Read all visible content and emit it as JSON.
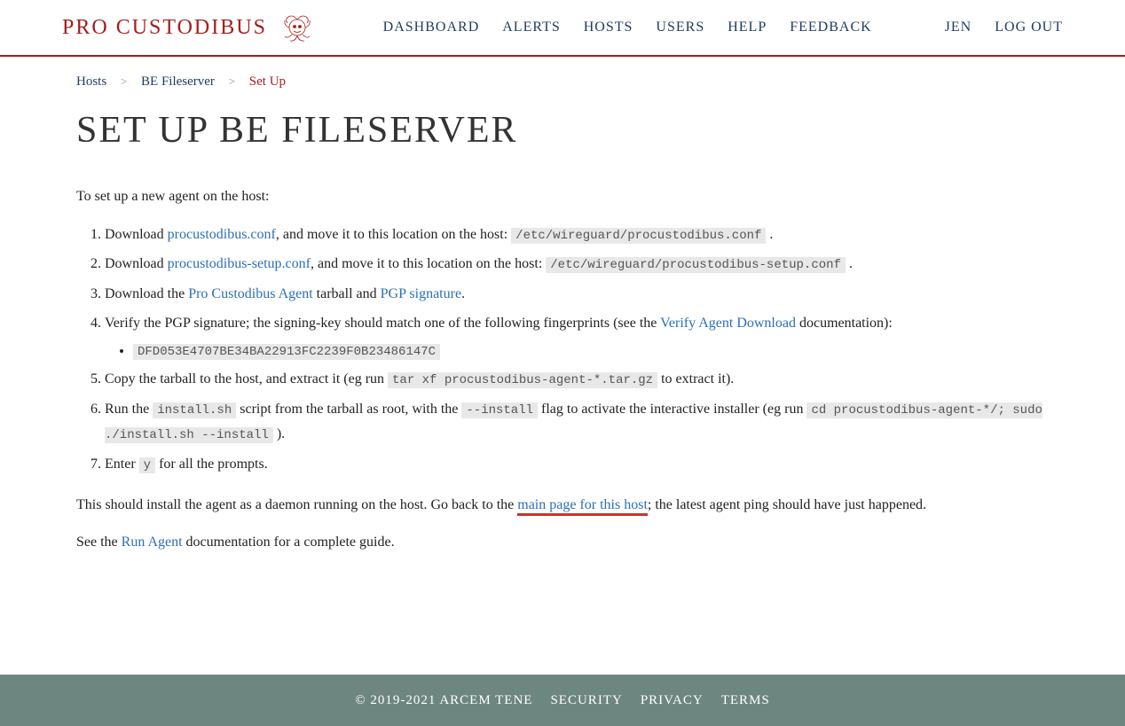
{
  "header": {
    "logo_text": "PRO CUSTODIBUS",
    "nav": [
      "DASHBOARD",
      "ALERTS",
      "HOSTS",
      "USERS",
      "HELP",
      "FEEDBACK"
    ],
    "user": "JEN",
    "logout": "LOG OUT"
  },
  "breadcrumbs": {
    "items": [
      {
        "label": "Hosts"
      },
      {
        "label": "BE Fileserver"
      }
    ],
    "current": "Set Up"
  },
  "title": "SET UP BE FILESERVER",
  "intro": "To set up a new agent on the host:",
  "steps": {
    "s1_a": "Download ",
    "s1_link": "procustodibus.conf",
    "s1_b": ", and move it to this location on the host: ",
    "s1_code": "/etc/wireguard/procustodibus.conf",
    "s1_c": " .",
    "s2_a": "Download ",
    "s2_link": "procustodibus-setup.conf",
    "s2_b": ", and move it to this location on the host: ",
    "s2_code": "/etc/wireguard/procustodibus-setup.conf",
    "s2_c": " .",
    "s3_a": "Download the ",
    "s3_link1": "Pro Custodibus Agent",
    "s3_b": " tarball and ",
    "s3_link2": "PGP signature",
    "s3_c": ".",
    "s4_a": "Verify the PGP signature; the signing-key should match one of the following fingerprints (see the ",
    "s4_link": "Verify Agent Download",
    "s4_b": " documentation):",
    "s4_fp": "DFD053E4707BE34BA22913FC2239F0B23486147C",
    "s5_a": "Copy the tarball to the host, and extract it (eg run ",
    "s5_code": "tar xf procustodibus-agent-*.tar.gz",
    "s5_b": " to extract it).",
    "s6_a": "Run the ",
    "s6_code1": "install.sh",
    "s6_b": " script from the tarball as root, with the ",
    "s6_code2": "--install",
    "s6_c": " flag to activate the interactive installer (eg run ",
    "s6_code3": "cd procustodibus-agent-*/; sudo ./install.sh --install",
    "s6_d": " ).",
    "s7_a": "Enter ",
    "s7_code": "y",
    "s7_b": " for all the prompts."
  },
  "outro1_a": "This should install the agent as a daemon running on the host. Go back to the ",
  "outro1_link": "main page for this host",
  "outro1_b": "; the latest agent ping should have just happened.",
  "outro2_a": "See the ",
  "outro2_link": "Run Agent",
  "outro2_b": " documentation for a complete guide.",
  "footer": {
    "copyright": "© 2019-2021 ARCEM TENE",
    "links": [
      "SECURITY",
      "PRIVACY",
      "TERMS"
    ]
  }
}
